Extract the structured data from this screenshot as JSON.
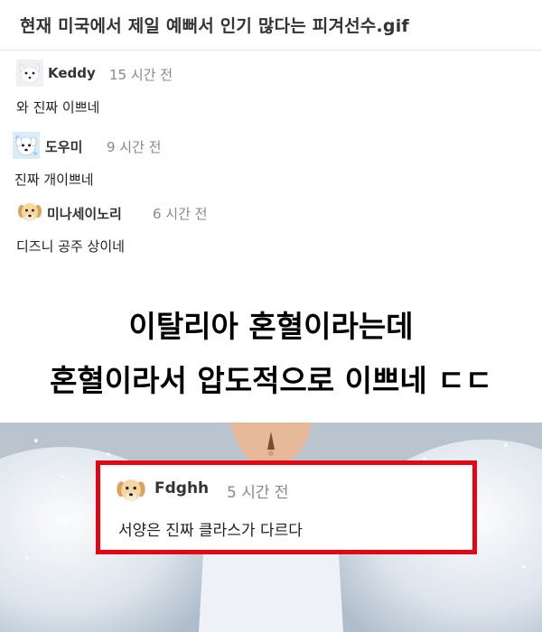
{
  "post": {
    "title": "현재 미국에서 제일 예뻐서 인기 많다는 피겨선수.gif"
  },
  "comments": [
    {
      "author": "Keddy",
      "time": "15 시간 전",
      "text": "와 진짜 이쁘네",
      "avatar_icon": "arctic-fox-icon"
    },
    {
      "author": "도우미",
      "time": "9 시간 전",
      "text": "진짜 개이쁘네",
      "avatar_icon": "white-dog-icon"
    },
    {
      "author": "미나세이노리",
      "time": "6 시간 전",
      "text": "디즈니 공주 상이네",
      "avatar_icon": "puppy-icon"
    }
  ],
  "caption": {
    "line1": "이탈리아 혼혈이라는데",
    "line2": "혼혈이라서 압도적으로 이쁘네 ㄷㄷ"
  },
  "overlay_comment": {
    "author": "Fdghh",
    "time": "5 시간 전",
    "text": "서양은 진짜 클라스가 다르다",
    "avatar_icon": "puppy-icon",
    "border_color": "#e30613"
  }
}
